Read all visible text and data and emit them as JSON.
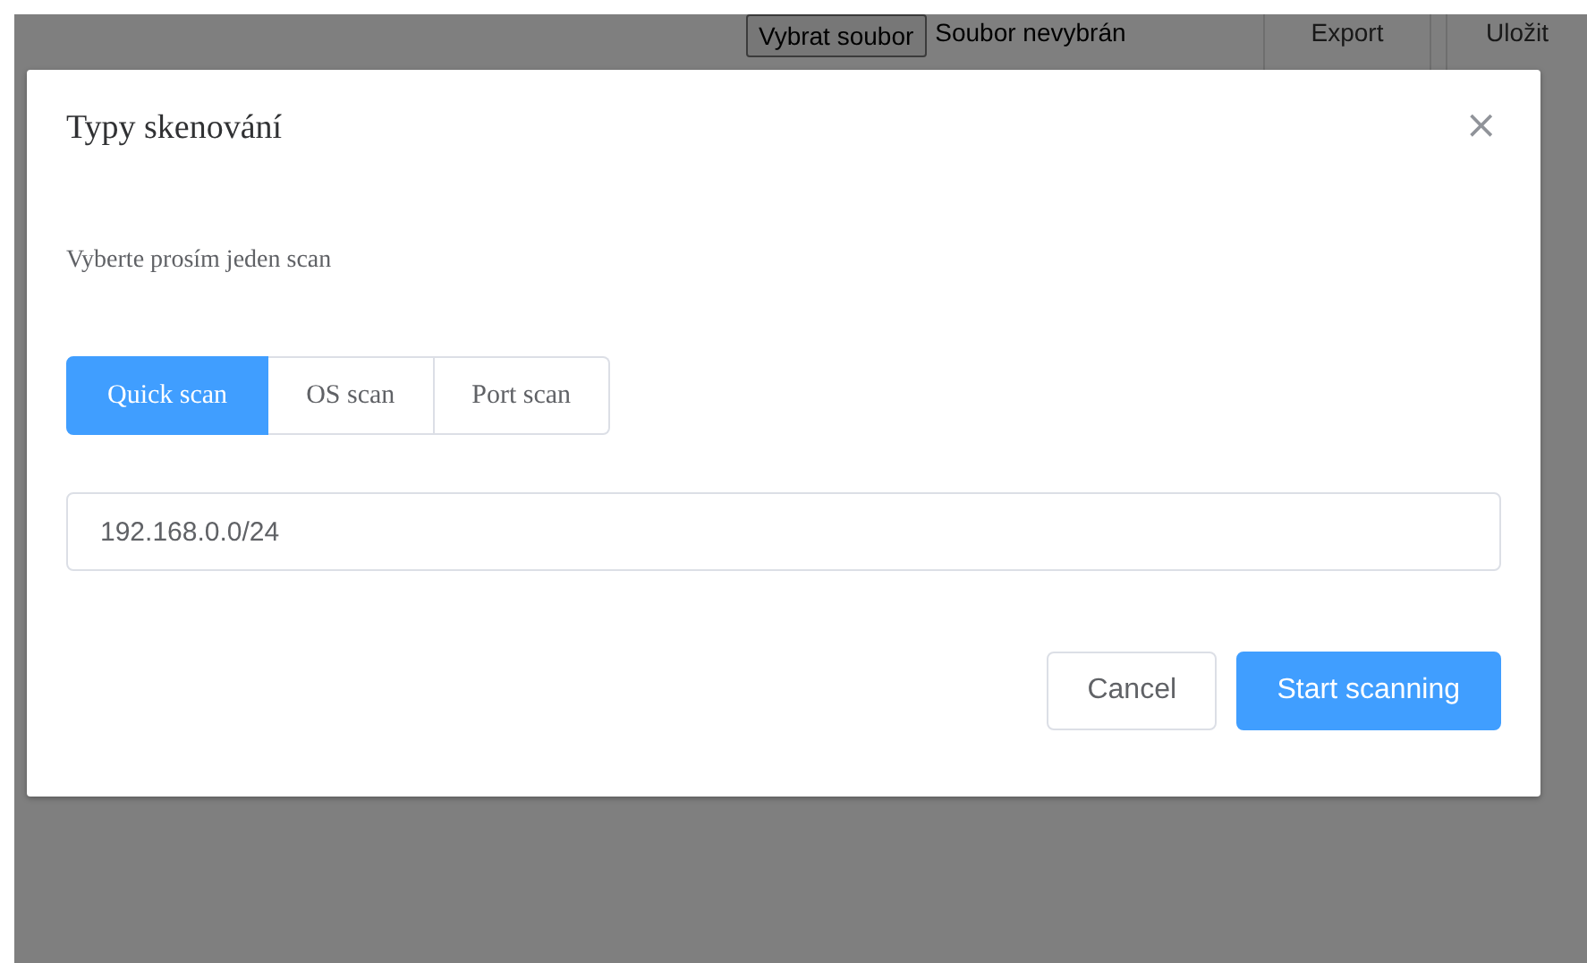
{
  "toolbar": {
    "file_button": "Vybrat soubor",
    "file_status": "Soubor nevybrán",
    "buttons": [
      "Export",
      "Uložit"
    ]
  },
  "dialog": {
    "title": "Typy skenování",
    "close": "×",
    "prompt": "Vyberte prosím jeden scan",
    "scan_types": [
      {
        "label": "Quick scan",
        "selected": true
      },
      {
        "label": "OS scan",
        "selected": false
      },
      {
        "label": "Port scan",
        "selected": false
      }
    ],
    "target": {
      "value": "192.168.0.0/24"
    },
    "buttons": [
      {
        "label": "Cancel",
        "kind": "secondary"
      },
      {
        "label": "Start scanning",
        "kind": "primary"
      }
    ]
  }
}
